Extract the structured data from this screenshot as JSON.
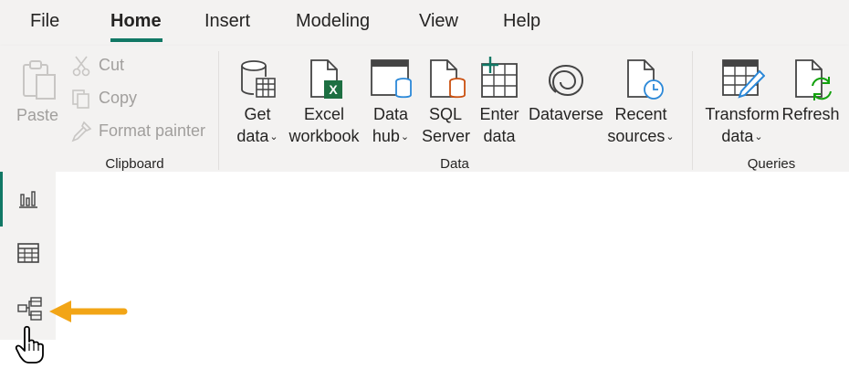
{
  "tabs": [
    {
      "label": "File"
    },
    {
      "label": "Home"
    },
    {
      "label": "Insert"
    },
    {
      "label": "Modeling"
    },
    {
      "label": "View"
    },
    {
      "label": "Help"
    }
  ],
  "active_tab": "Home",
  "groups": {
    "clipboard": "Clipboard",
    "data": "Data",
    "queries": "Queries"
  },
  "clipboard": {
    "paste": "Paste",
    "cut": "Cut",
    "copy": "Copy",
    "format_painter": "Format painter"
  },
  "data_buttons": {
    "get_data": [
      "Get",
      "data"
    ],
    "excel": [
      "Excel",
      "workbook"
    ],
    "data_hub": [
      "Data",
      "hub"
    ],
    "sql": [
      "SQL",
      "Server"
    ],
    "enter_data": [
      "Enter",
      "data"
    ],
    "dataverse": [
      "Dataverse"
    ],
    "recent": [
      "Recent",
      "sources"
    ]
  },
  "query_buttons": {
    "transform": [
      "Transform",
      "data"
    ],
    "refresh": [
      "Refresh"
    ]
  },
  "rail": [
    {
      "icon": "report-view-icon"
    },
    {
      "icon": "table-view-icon"
    },
    {
      "icon": "model-view-icon"
    }
  ],
  "colors": {
    "accent": "#117865",
    "ribbon_bg": "#f3f2f1",
    "arrow": "#f2a516",
    "excel_green": "#1d6f42",
    "blue": "#2b88d8"
  }
}
